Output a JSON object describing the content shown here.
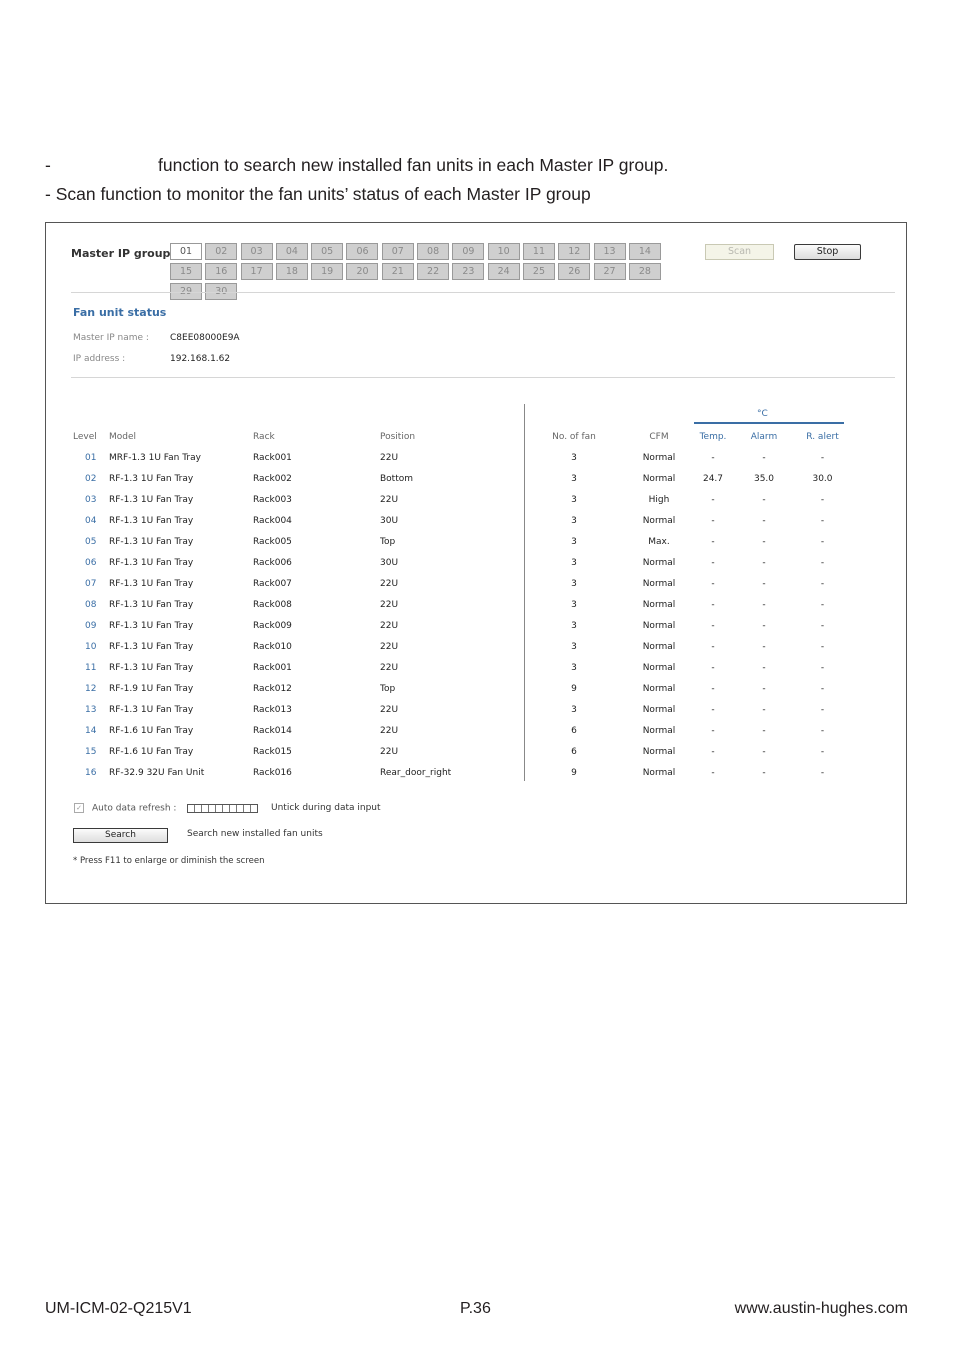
{
  "intro": {
    "line1": "function to search new installed fan units in each Master IP group.",
    "line2": "- Scan function to monitor the fan units’ status of each Master IP group"
  },
  "panel": {
    "group_label": "Master IP groups",
    "groups": [
      "01",
      "02",
      "03",
      "04",
      "05",
      "06",
      "07",
      "08",
      "09",
      "10",
      "11",
      "12",
      "13",
      "14",
      "15",
      "16",
      "17",
      "18",
      "19",
      "20",
      "21",
      "22",
      "23",
      "24",
      "25",
      "26",
      "27",
      "28",
      "29",
      "30"
    ],
    "selected_group": "01",
    "scan_label": "Scan",
    "stop_label": "Stop",
    "status_title": "Fan unit status",
    "info": {
      "name_key": "Master IP name :",
      "name_val": "C8EE08000E9A",
      "ip_key": "IP address :",
      "ip_val": "192.168.1.62"
    },
    "unit_label": "°C",
    "columns": {
      "level": "Level",
      "model": "Model",
      "rack": "Rack",
      "position": "Position",
      "fans": "No. of fan",
      "cfm": "CFM",
      "temp": "Temp.",
      "alarm": "Alarm",
      "ralert": "R. alert"
    },
    "rows": [
      {
        "level": "01",
        "model": "MRF-1.3 1U Fan Tray",
        "rack": "Rack001",
        "position": "22U",
        "fans": "3",
        "cfm": "Normal",
        "temp": "-",
        "alarm": "-",
        "ralert": "-"
      },
      {
        "level": "02",
        "model": "RF-1.3 1U Fan Tray",
        "rack": "Rack002",
        "position": "Bottom",
        "fans": "3",
        "cfm": "Normal",
        "temp": "24.7",
        "alarm": "35.0",
        "ralert": "30.0"
      },
      {
        "level": "03",
        "model": "RF-1.3 1U Fan Tray",
        "rack": "Rack003",
        "position": "22U",
        "fans": "3",
        "cfm": "High",
        "temp": "-",
        "alarm": "-",
        "ralert": "-"
      },
      {
        "level": "04",
        "model": "RF-1.3 1U Fan Tray",
        "rack": "Rack004",
        "position": "30U",
        "fans": "3",
        "cfm": "Normal",
        "temp": "-",
        "alarm": "-",
        "ralert": "-"
      },
      {
        "level": "05",
        "model": "RF-1.3 1U Fan Tray",
        "rack": "Rack005",
        "position": "Top",
        "fans": "3",
        "cfm": "Max.",
        "temp": "-",
        "alarm": "-",
        "ralert": "-"
      },
      {
        "level": "06",
        "model": "RF-1.3 1U Fan Tray",
        "rack": "Rack006",
        "position": "30U",
        "fans": "3",
        "cfm": "Normal",
        "temp": "-",
        "alarm": "-",
        "ralert": "-"
      },
      {
        "level": "07",
        "model": "RF-1.3 1U Fan Tray",
        "rack": "Rack007",
        "position": "22U",
        "fans": "3",
        "cfm": "Normal",
        "temp": "-",
        "alarm": "-",
        "ralert": "-"
      },
      {
        "level": "08",
        "model": "RF-1.3 1U Fan Tray",
        "rack": "Rack008",
        "position": "22U",
        "fans": "3",
        "cfm": "Normal",
        "temp": "-",
        "alarm": "-",
        "ralert": "-"
      },
      {
        "level": "09",
        "model": "RF-1.3 1U Fan Tray",
        "rack": "Rack009",
        "position": "22U",
        "fans": "3",
        "cfm": "Normal",
        "temp": "-",
        "alarm": "-",
        "ralert": "-"
      },
      {
        "level": "10",
        "model": "RF-1.3 1U Fan Tray",
        "rack": "Rack010",
        "position": "22U",
        "fans": "3",
        "cfm": "Normal",
        "temp": "-",
        "alarm": "-",
        "ralert": "-"
      },
      {
        "level": "11",
        "model": "RF-1.3 1U Fan Tray",
        "rack": "Rack001",
        "position": "22U",
        "fans": "3",
        "cfm": "Normal",
        "temp": "-",
        "alarm": "-",
        "ralert": "-"
      },
      {
        "level": "12",
        "model": "RF-1.9 1U Fan Tray",
        "rack": "Rack012",
        "position": "Top",
        "fans": "9",
        "cfm": "Normal",
        "temp": "-",
        "alarm": "-",
        "ralert": "-"
      },
      {
        "level": "13",
        "model": "RF-1.3 1U Fan Tray",
        "rack": "Rack013",
        "position": "22U",
        "fans": "3",
        "cfm": "Normal",
        "temp": "-",
        "alarm": "-",
        "ralert": "-"
      },
      {
        "level": "14",
        "model": "RF-1.6 1U Fan Tray",
        "rack": "Rack014",
        "position": "22U",
        "fans": "6",
        "cfm": "Normal",
        "temp": "-",
        "alarm": "-",
        "ralert": "-"
      },
      {
        "level": "15",
        "model": "RF-1.6 1U Fan Tray",
        "rack": "Rack015",
        "position": "22U",
        "fans": "6",
        "cfm": "Normal",
        "temp": "-",
        "alarm": "-",
        "ralert": "-"
      },
      {
        "level": "16",
        "model": "RF-32.9 32U Fan Unit",
        "rack": "Rack016",
        "position": "Rear_door_right",
        "fans": "9",
        "cfm": "Normal",
        "temp": "-",
        "alarm": "-",
        "ralert": "-"
      }
    ],
    "auto_refresh_label": "Auto data refresh :",
    "auto_refresh_checked": true,
    "untick_note": "Untick during data input",
    "search_label": "Search",
    "search_note": "Search new installed fan units",
    "f11_note": "* Press F11 to enlarge or diminish the screen"
  },
  "footer": {
    "doc_id": "UM-ICM-02-Q215V1",
    "page": "P.36",
    "website": "www.austin-hughes.com"
  }
}
